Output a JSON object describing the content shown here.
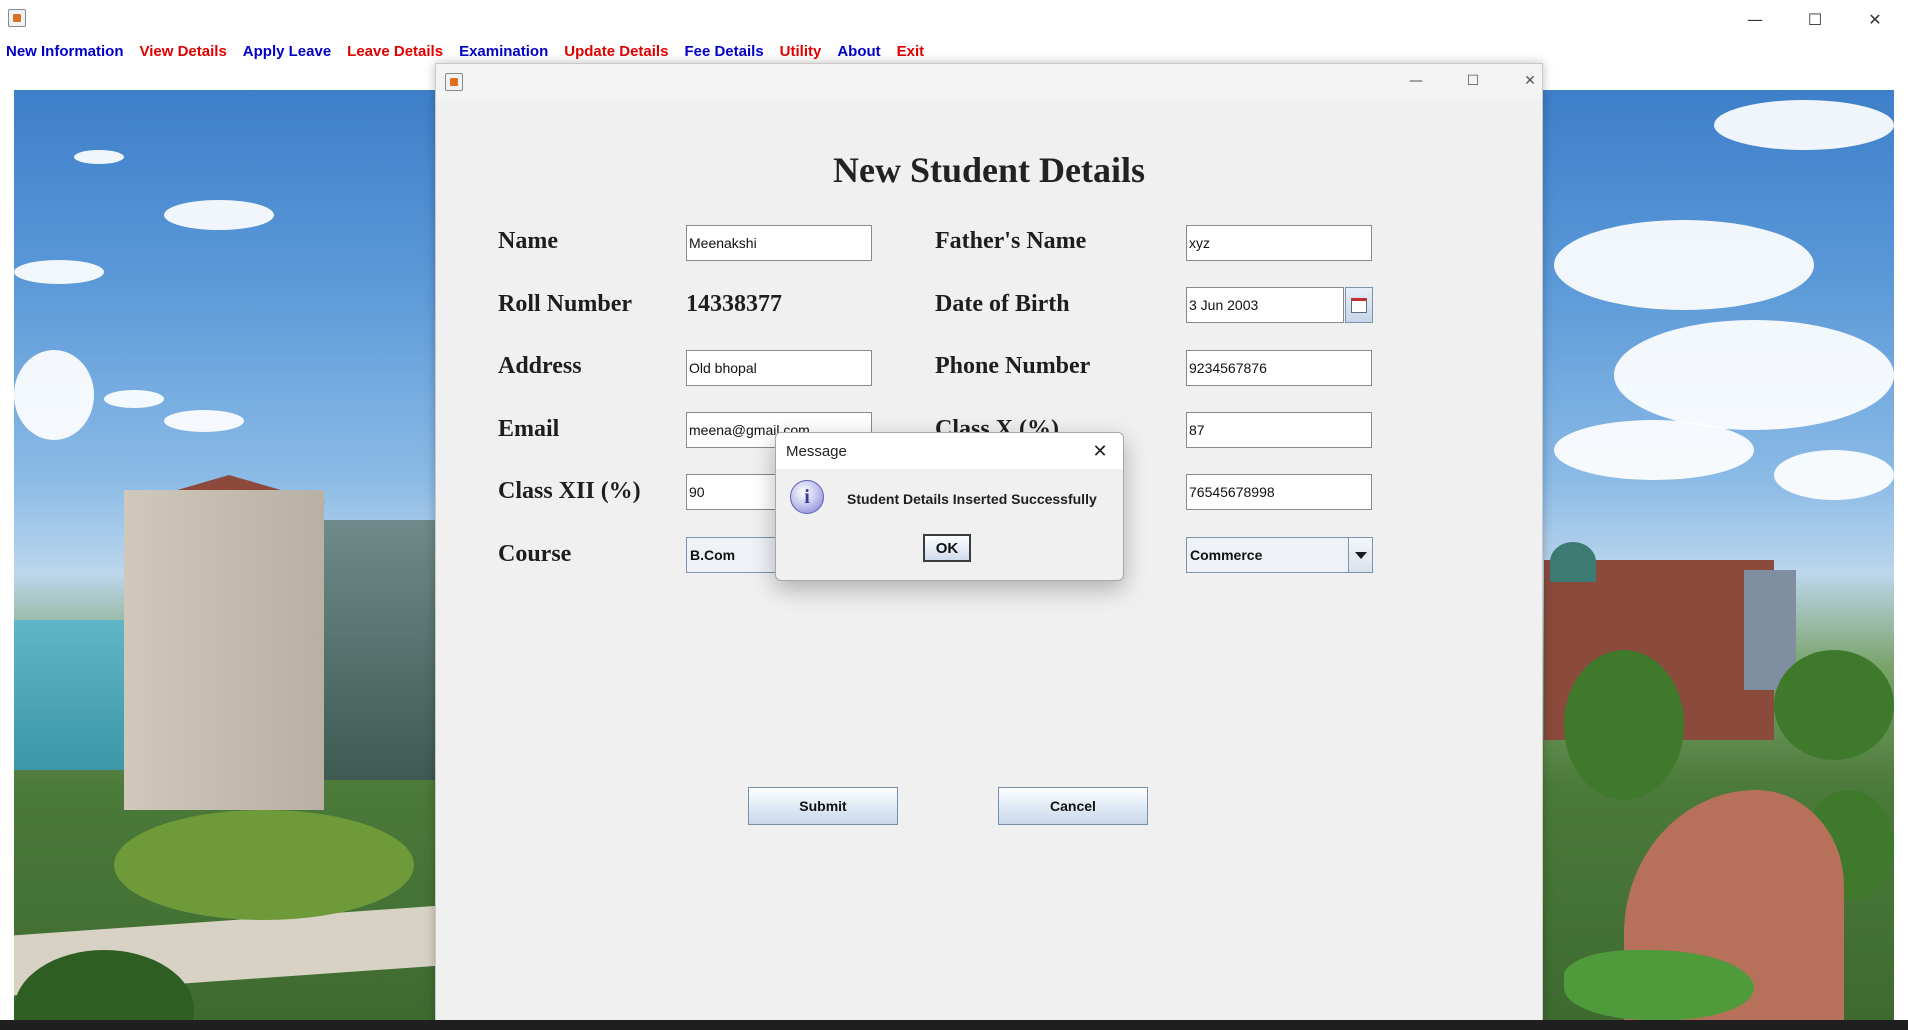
{
  "app": {
    "window_controls": {
      "minimize": "—",
      "maximize": "☐",
      "close": "✕"
    }
  },
  "menu": {
    "items": [
      {
        "label": "New Information",
        "color": "#0000c8"
      },
      {
        "label": "View Details",
        "color": "#e00000"
      },
      {
        "label": "Apply Leave",
        "color": "#0000c8"
      },
      {
        "label": "Leave Details",
        "color": "#e00000"
      },
      {
        "label": "Examination",
        "color": "#0000c8"
      },
      {
        "label": "Update Details",
        "color": "#e00000"
      },
      {
        "label": "Fee Details",
        "color": "#0000c8"
      },
      {
        "label": "Utility",
        "color": "#e00000"
      },
      {
        "label": "About",
        "color": "#0000c8"
      },
      {
        "label": "Exit",
        "color": "#e00000"
      }
    ]
  },
  "form": {
    "heading": "New Student Details",
    "labels": {
      "name": "Name",
      "fathers_name": "Father's Name",
      "roll_number": "Roll Number",
      "dob": "Date of Birth",
      "address": "Address",
      "phone": "Phone Number",
      "email": "Email",
      "class_x": "Class X (%)",
      "class_xii": "Class XII (%)",
      "course": "Course"
    },
    "values": {
      "name": "Meenakshi",
      "fathers_name": "xyz",
      "roll_number": "14338377",
      "dob": "3 Jun 2003",
      "address": "Old bhopal",
      "phone": "9234567876",
      "email": "meena@gmail.com",
      "class_x": "87",
      "class_xii": "90",
      "aadhar": "76545678998",
      "course": "B.Com",
      "branch": "Commerce"
    },
    "buttons": {
      "submit": "Submit",
      "cancel": "Cancel"
    }
  },
  "dialog": {
    "title": "Message",
    "close": "✕",
    "icon": "i",
    "message": "Student Details Inserted Successfully",
    "ok": "OK"
  }
}
